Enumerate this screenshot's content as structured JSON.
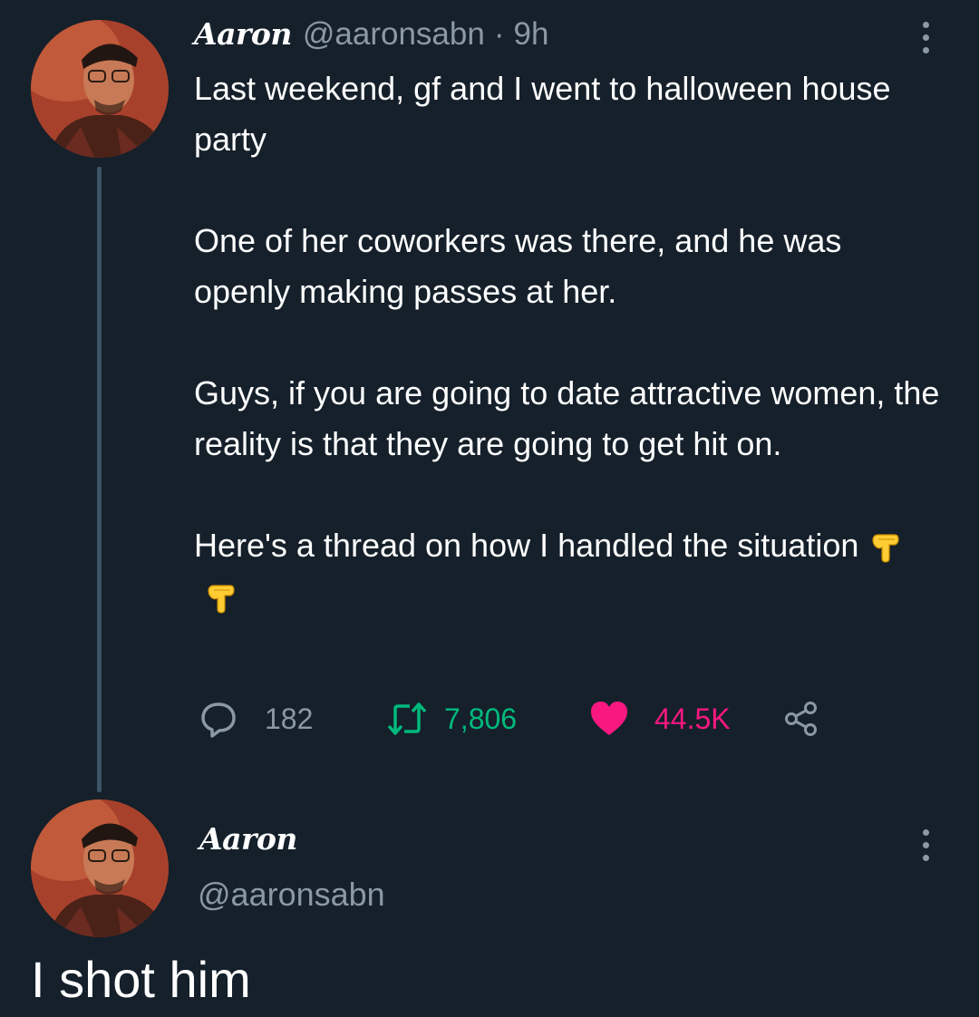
{
  "tweet": {
    "author_name": "Aaron",
    "handle": "@aaronsabn",
    "separator": "·",
    "time": "9h",
    "paragraphs": [
      "Last weekend, gf and I went to halloween house party",
      "One of her coworkers was there, and he was openly making passes at her.",
      "Guys, if you are going to date attractive women, the reality is that they are going to get hit on.",
      "Here's a thread on how I handled the situation"
    ],
    "emojis": [
      "backhand-index-pointing-down",
      "backhand-index-pointing-down"
    ],
    "stats": {
      "replies": "182",
      "retweets": "7,806",
      "likes": "44.5K"
    }
  },
  "reply": {
    "author_name": "Aaron",
    "handle": "@aaronsabn",
    "text": "I shot him"
  },
  "colors": {
    "background": "#15202b",
    "secondary_text": "#8b98a5",
    "retweet_green": "#00ba7c",
    "like_pink": "#f91880",
    "thread_line": "#3d5466"
  },
  "icons": [
    "more-icon",
    "reply-icon",
    "retweet-icon",
    "like-heart-icon",
    "share-icon"
  ]
}
